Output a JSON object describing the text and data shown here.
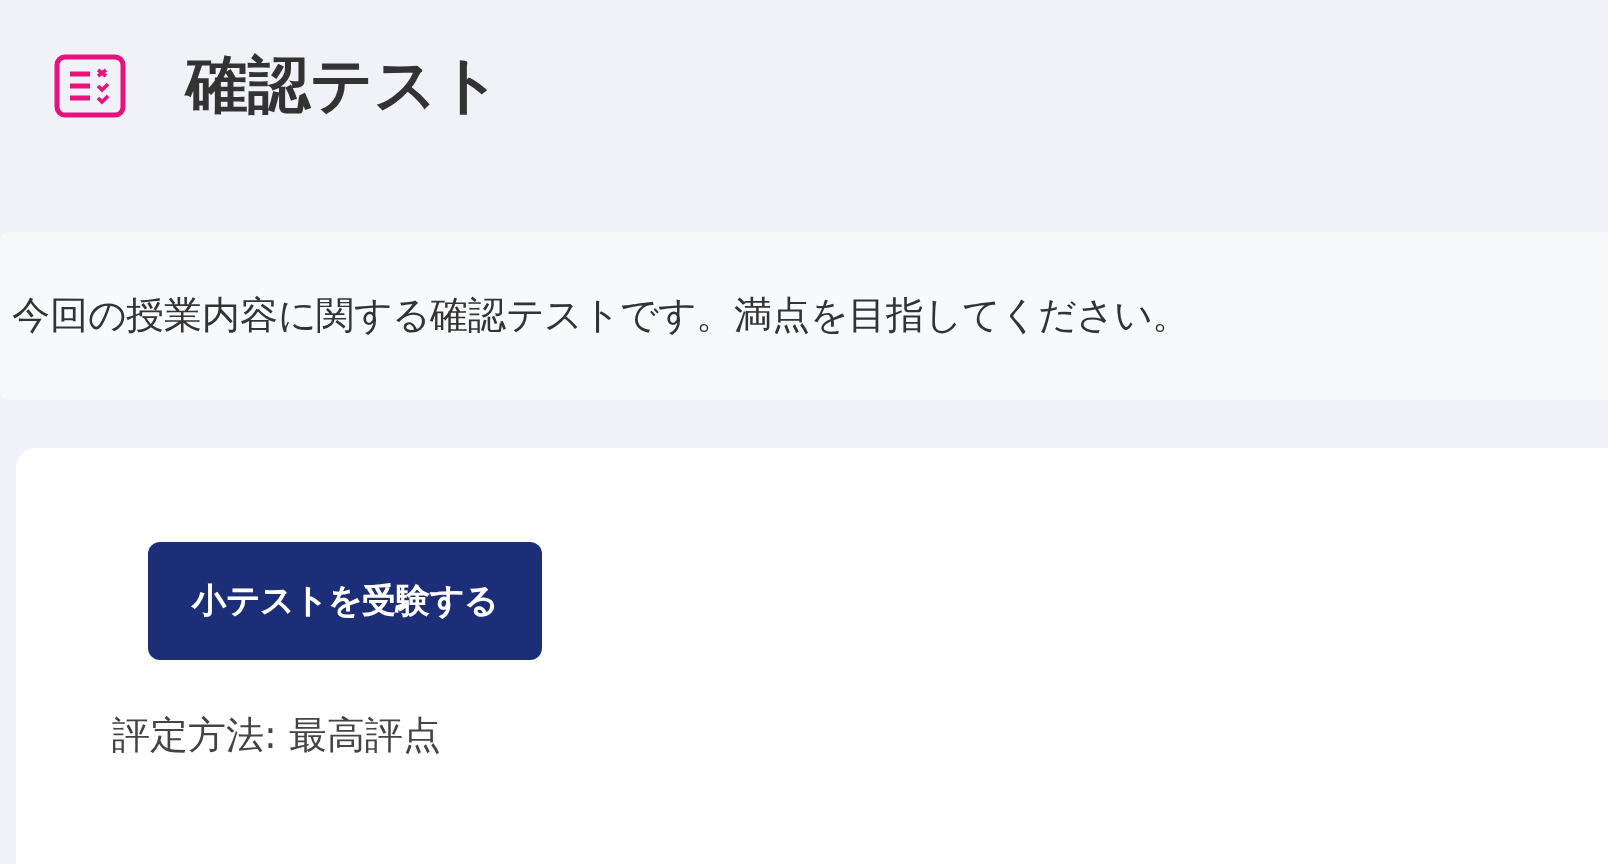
{
  "header": {
    "title": "確認テスト"
  },
  "description": "今回の授業内容に関する確認テストです。満点を目指してください。",
  "card": {
    "button": "小テストを受験する",
    "grading": "評定方法: 最高評点"
  }
}
